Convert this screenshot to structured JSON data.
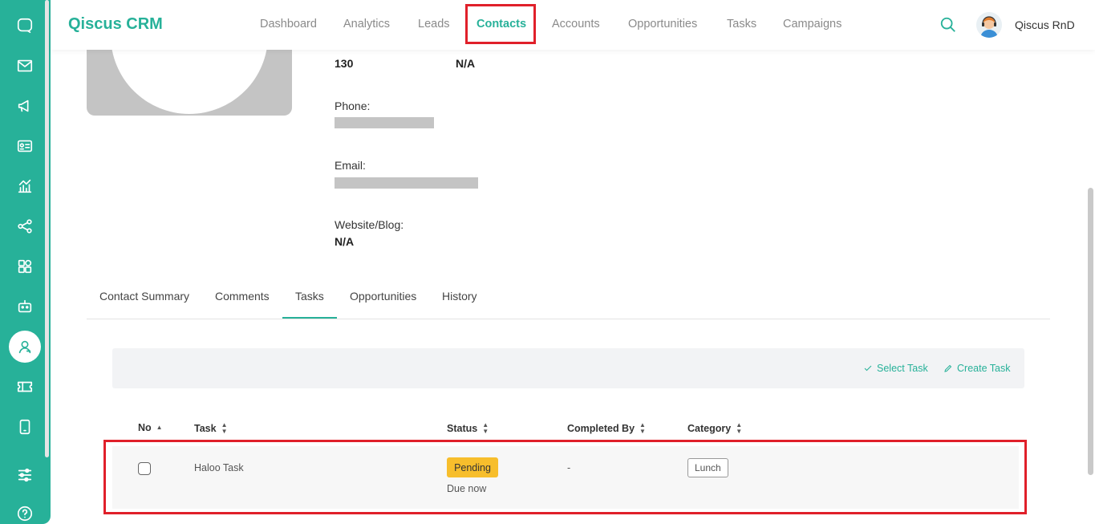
{
  "header": {
    "brand": "Qiscus CRM",
    "nav": [
      {
        "label": "Dashboard"
      },
      {
        "label": "Analytics"
      },
      {
        "label": "Leads"
      },
      {
        "label": "Contacts"
      },
      {
        "label": "Accounts"
      },
      {
        "label": "Opportunities"
      },
      {
        "label": "Tasks"
      },
      {
        "label": "Campaigns"
      }
    ],
    "active_nav": "Contacts",
    "user_name": "Qiscus RnD"
  },
  "profile": {
    "top_value_1": "130",
    "top_value_2": "N/A",
    "phone_label": "Phone:",
    "email_label": "Email:",
    "website_label": "Website/Blog:",
    "website_value": "N/A"
  },
  "tabs": [
    {
      "label": "Contact Summary"
    },
    {
      "label": "Comments"
    },
    {
      "label": "Tasks"
    },
    {
      "label": "Opportunities"
    },
    {
      "label": "History"
    }
  ],
  "active_tab": "Tasks",
  "toolbar": {
    "select_task": "Select Task",
    "create_task": "Create Task"
  },
  "table": {
    "columns": [
      {
        "label": "No"
      },
      {
        "label": "Task"
      },
      {
        "label": "Status"
      },
      {
        "label": "Completed By"
      },
      {
        "label": "Category"
      }
    ],
    "rows": [
      {
        "task": "Haloo Task",
        "status": "Pending",
        "due": "Due now",
        "completed_by": "-",
        "category": "Lunch"
      }
    ]
  },
  "colors": {
    "brand": "#27b199",
    "highlight": "#e0202a",
    "pending": "#f7be2c"
  }
}
